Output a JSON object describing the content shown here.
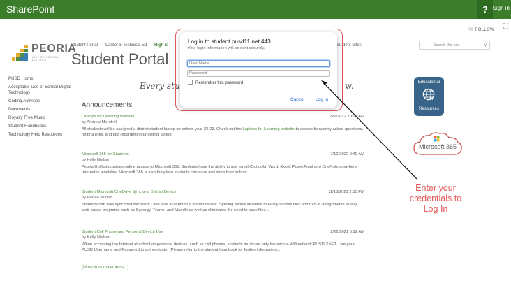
{
  "suitebar": {
    "brand": "SharePoint",
    "help": "?",
    "signin": "Sign in"
  },
  "follow": {
    "label": "FOLLOW"
  },
  "logo": {
    "name": "PEORIA",
    "sub": "UNIFIED SCHOOL DISTRICT"
  },
  "topnav": {
    "items": [
      "Student Portal",
      "Career & Technical Ed",
      "High S"
    ],
    "right": "Student Sites"
  },
  "site_title": "Student Portal",
  "search": {
    "placeholder": "Search this site"
  },
  "leftnav": {
    "items": [
      "PUSD Home",
      "Acceptable Use of School Digital Technology",
      "Coding Activities",
      "Documents",
      "Royalty Free Music",
      "Student Handbooks",
      "Technology Help Resources"
    ]
  },
  "tagline": {
    "left": "Every stude",
    "right": "w."
  },
  "announcements": {
    "title": "Announcements",
    "items": [
      {
        "title": "Laptops for Learning Website",
        "by": "by Andrew Mendivil",
        "date": "8/2/2022 10:27 AM",
        "body_pre": "All students will be assigned a district student laptop for school year 22-23. Check out the ",
        "body_link": "Laptops for Learning website",
        "body_post": " to access frequently asked questions, helpful links, and tips regarding your district laptop."
      },
      {
        "title": "Microsoft 365 for Students",
        "by": "by Kelly Nielsen",
        "date": "7/12/2022 9:40 AM",
        "body": "Peoria Unified provides online access to Microsoft 365. Students have the ability to use email (Outlook), Word, Excel, PowerPoint and OneNote anywhere Internet is available. Microsoft 365 is also the place students can save and store their school..."
      },
      {
        "title": "Student Microsoft OneDrive Sync to a District Device",
        "by": "by Renee Nunez",
        "date": "11/18/2021 2:53 PM",
        "body": "Students can now sync their Microsoft OneDrive account to a district device. Syncing allows students to easily access files and turn-in assignments to any web-based programs such as Synergy, Teams, and Moodle as well as eliminates the need to save files..."
      },
      {
        "title": "Student Cell Phone and Personal Device Use",
        "by": "by Kelly Nielsen",
        "date": "2/22/2021 6:12 AM",
        "body": "When accessing the Internet at school on personal devices, such as cell phones, students must use only the secure Wifi network PUSD-XNET. Use your PUSD Username and Password to authenticate. (Please refer to the student handbook for further information..."
      }
    ],
    "more": "(More Announcements...)"
  },
  "tiles": {
    "edu_line1": "Educational",
    "edu_line2": "Resources",
    "ms365": "Microsoft 365"
  },
  "modal": {
    "title": "Log in to student.pusd11.net:443",
    "subtitle": "Your login information will be sent securely.",
    "username_placeholder": "User Name",
    "password_placeholder": "Password",
    "remember": "Remember this password",
    "cancel": "Cancel",
    "login": "Log In"
  },
  "annotation": {
    "line1": "Enter your",
    "line2": "credentials to",
    "line3": "Log In"
  },
  "colors": {
    "brand_green": "#3b7d2a",
    "link_blue": "#2a6fd6",
    "annotation_red": "#e55656",
    "tile_blue": "#1c4f78"
  }
}
